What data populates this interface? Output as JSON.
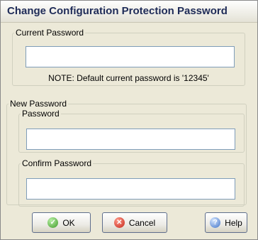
{
  "window": {
    "title": "Change Configuration Protection Password"
  },
  "current_password": {
    "legend": "Current Password",
    "value": "",
    "note": "NOTE: Default current password is '12345'"
  },
  "new_password": {
    "legend": "New Password",
    "password": {
      "legend": "Password",
      "value": ""
    },
    "confirm": {
      "legend": "Confirm Password",
      "value": ""
    }
  },
  "buttons": {
    "ok": {
      "label": "OK",
      "icon": "ok-check-icon"
    },
    "cancel": {
      "label": "Cancel",
      "icon": "cancel-x-icon"
    },
    "help": {
      "label": "Help",
      "icon": "help-question-icon"
    }
  },
  "colors": {
    "dialog_bg": "#ece9d8",
    "title_text": "#1e2b57",
    "input_border": "#7f9db9"
  }
}
